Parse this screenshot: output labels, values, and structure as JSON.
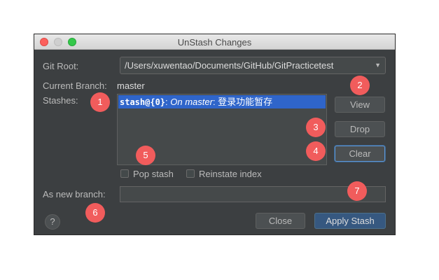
{
  "window": {
    "title": "UnStash Changes"
  },
  "git_root": {
    "label": "Git Root:",
    "value": "/Users/xuwentao/Documents/GitHub/GitPracticetest"
  },
  "current_branch": {
    "label": "Current Branch:",
    "value": "master"
  },
  "stashes": {
    "label": "Stashes:",
    "items": [
      {
        "ref": "stash@{0}",
        "sep": ": ",
        "on": "On master",
        "message": ": 登录功能暂存"
      }
    ]
  },
  "buttons": {
    "view": "View",
    "drop": "Drop",
    "clear": "Clear",
    "close": "Close",
    "apply": "Apply Stash",
    "help": "?"
  },
  "options": {
    "pop_stash": "Pop stash",
    "reinstate_index": "Reinstate index"
  },
  "new_branch": {
    "label": "As new branch:",
    "value": ""
  },
  "annotations": [
    "1",
    "2",
    "3",
    "4",
    "5",
    "6",
    "7"
  ],
  "colors": {
    "dialog_bg": "#3c3f41",
    "selection": "#2f65ca",
    "primary_button": "#365880",
    "badge": "#f15c5c"
  }
}
